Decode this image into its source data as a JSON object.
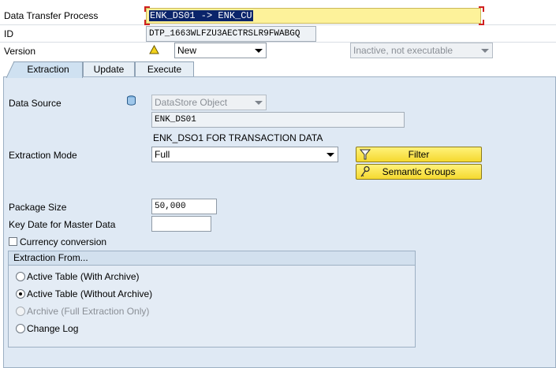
{
  "header": {
    "dtp_label": "Data Transfer Process",
    "dtp_value": "ENK_DS01 -> ENK_CU",
    "id_label": "ID",
    "id_value": "DTP_1663WLFZU3AECTRSLR9FWABGQ",
    "version_label": "Version",
    "version_icon": "warning-triangle-icon",
    "version_value": "New",
    "status_value": "Inactive, not executable"
  },
  "tabs": [
    {
      "label": "Extraction"
    },
    {
      "label": "Update"
    },
    {
      "label": "Execute"
    }
  ],
  "extraction": {
    "data_source_label": "Data Source",
    "data_source_icon": "database-icon",
    "data_source_type": "DataStore Object",
    "data_source_name": "ENK_DS01",
    "data_source_desc": "ENK_DSO1 FOR TRANSACTION DATA",
    "extraction_mode_label": "Extraction Mode",
    "extraction_mode_value": "Full",
    "filter_button": "Filter",
    "filter_icon": "filter-funnel-icon",
    "semantic_groups_button": "Semantic Groups",
    "semantic_groups_icon": "key-icon",
    "package_size_label": "Package Size",
    "package_size_value": "50,000",
    "key_date_label": "Key Date for Master Data",
    "key_date_value": "",
    "currency_conversion_label": "Currency conversion",
    "currency_conversion_checked": false,
    "extraction_from": {
      "title": "Extraction From...",
      "options": [
        {
          "label": "Active Table (With Archive)",
          "selected": false,
          "disabled": false
        },
        {
          "label": "Active Table (Without Archive)",
          "selected": true,
          "disabled": false
        },
        {
          "label": "Archive (Full Extraction Only)",
          "selected": false,
          "disabled": true
        },
        {
          "label": "Change Log",
          "selected": false,
          "disabled": false
        }
      ]
    }
  },
  "colors": {
    "panel_bg": "#dfe9f4",
    "highlight_field": "#fdf29a",
    "selection_bg": "#0a246a",
    "button_yellow": "#f5d930"
  }
}
